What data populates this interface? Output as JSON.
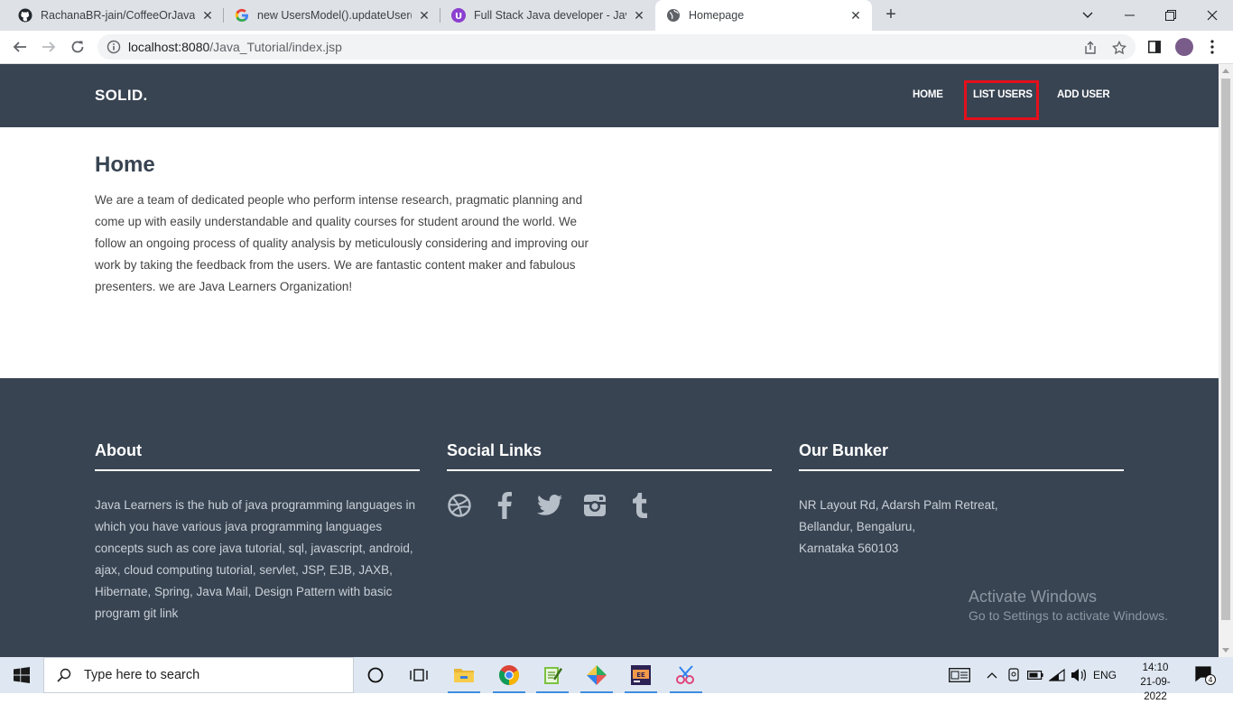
{
  "browser": {
    "tabs": [
      {
        "title": "RachanaBR-jain/CoffeeOrJava: Th",
        "icon": "github-icon"
      },
      {
        "title": "new UsersModel().updateUser(da",
        "icon": "google-icon"
      },
      {
        "title": "Full Stack Java developer - Java -",
        "icon": "udemy-icon"
      },
      {
        "title": "Homepage",
        "icon": "globe-icon"
      }
    ],
    "url_host": "localhost:8080",
    "url_path": "/Java_Tutorial/index.jsp"
  },
  "site": {
    "brand": "SOLID.",
    "nav": {
      "home": "HOME",
      "list_users": "LIST USERS",
      "add_user": "ADD USER"
    },
    "colors": {
      "header_bg": "#384452",
      "highlight": "#e3101c"
    }
  },
  "main": {
    "title": "Home",
    "text": "We are a team of dedicated people who perform intense research, pragmatic planning and come up with easily understandable and quality courses for student around the world. We follow an ongoing process of quality analysis by meticulously considering and improving our work by taking the feedback from the users. We are fantastic content maker and fabulous presenters. we are Java Learners Organization!"
  },
  "footer": {
    "about": {
      "heading": "About",
      "text": "Java Learners is the hub of java programming languages in which you have various java programming languages concepts such as core java tutorial, sql, javascript, android, ajax, cloud computing tutorial, servlet, JSP, EJB, JAXB, Hibernate, Spring, Java Mail, Design Pattern with basic program git link"
    },
    "social": {
      "heading": "Social Links",
      "icons": [
        "dribbble-icon",
        "facebook-icon",
        "twitter-icon",
        "instagram-icon",
        "tumblr-icon"
      ]
    },
    "bunker": {
      "heading": "Our Bunker",
      "line1": "NR Layout Rd, Adarsh Palm Retreat,",
      "line2": "Bellandur, Bengaluru,",
      "line3": "Karnataka 560103"
    }
  },
  "watermark": {
    "line1": "Activate Windows",
    "line2": "Go to Settings to activate Windows."
  },
  "taskbar": {
    "search_placeholder": "Type here to search",
    "lang": "ENG",
    "time": "14:10",
    "date": "21-09-2022",
    "notifications": "4"
  }
}
